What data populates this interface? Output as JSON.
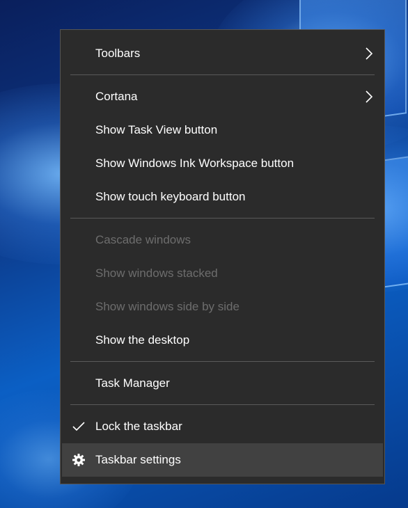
{
  "menu": {
    "items": [
      {
        "label": "Toolbars",
        "enabled": true,
        "submenu": true,
        "icon": "chevron-right-icon"
      },
      {
        "label": "Cortana",
        "enabled": true,
        "submenu": true,
        "icon": "chevron-right-icon"
      },
      {
        "label": "Show Task View button",
        "enabled": true
      },
      {
        "label": "Show Windows Ink Workspace button",
        "enabled": true
      },
      {
        "label": "Show touch keyboard button",
        "enabled": true
      },
      {
        "label": "Cascade windows",
        "enabled": false
      },
      {
        "label": "Show windows stacked",
        "enabled": false
      },
      {
        "label": "Show windows side by side",
        "enabled": false
      },
      {
        "label": "Show the desktop",
        "enabled": true
      },
      {
        "label": "Task Manager",
        "enabled": true
      },
      {
        "label": "Lock the taskbar",
        "enabled": true,
        "checked": true,
        "icon": "checkmark-icon"
      },
      {
        "label": "Taskbar settings",
        "enabled": true,
        "highlighted": true,
        "icon": "gear-icon"
      }
    ]
  },
  "colors": {
    "menu_bg": "#2b2b2b",
    "text": "#ffffff",
    "disabled_text": "#6d6d6d",
    "highlight_bg": "#414141",
    "separator": "#5a5a5a"
  }
}
